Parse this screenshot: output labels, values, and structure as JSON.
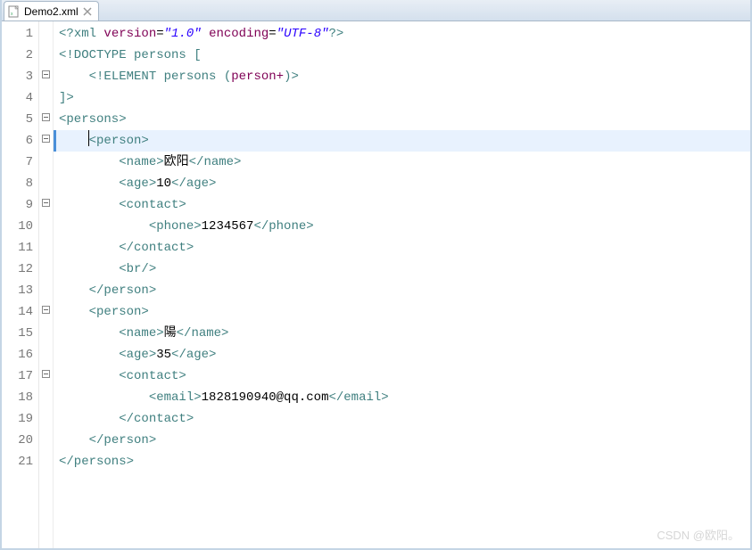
{
  "tab": {
    "filename": "Demo2.xml"
  },
  "lines": [
    {
      "num": "1",
      "fold": false,
      "highlight": false,
      "indent": 0,
      "segments": [
        {
          "t": "<?",
          "c": "tag"
        },
        {
          "t": "xml ",
          "c": "tag"
        },
        {
          "t": "version",
          "c": "attr"
        },
        {
          "t": "=",
          "c": "txt"
        },
        {
          "t": "\"1.0\"",
          "c": "val"
        },
        {
          "t": " ",
          "c": "txt"
        },
        {
          "t": "encoding",
          "c": "attr"
        },
        {
          "t": "=",
          "c": "txt"
        },
        {
          "t": "\"UTF-8\"",
          "c": "val"
        },
        {
          "t": "?>",
          "c": "tag"
        }
      ]
    },
    {
      "num": "2",
      "fold": false,
      "highlight": false,
      "indent": 0,
      "segments": [
        {
          "t": "<!DOCTYPE ",
          "c": "doctype"
        },
        {
          "t": "persons ",
          "c": "elname"
        },
        {
          "t": "[",
          "c": "brack"
        }
      ]
    },
    {
      "num": "3",
      "fold": true,
      "highlight": false,
      "indent": 1,
      "segments": [
        {
          "t": "<!ELEMENT ",
          "c": "doctype"
        },
        {
          "t": "persons ",
          "c": "elname"
        },
        {
          "t": "(",
          "c": "brack"
        },
        {
          "t": "person+",
          "c": "kw"
        },
        {
          "t": ")>",
          "c": "brack"
        }
      ]
    },
    {
      "num": "4",
      "fold": false,
      "highlight": false,
      "indent": 0,
      "segments": [
        {
          "t": "]>",
          "c": "brack"
        }
      ]
    },
    {
      "num": "5",
      "fold": true,
      "highlight": false,
      "indent": 0,
      "segments": [
        {
          "t": "<persons>",
          "c": "tag"
        }
      ]
    },
    {
      "num": "6",
      "fold": true,
      "highlight": true,
      "indent": 1,
      "segments": [
        {
          "t": "<person>",
          "c": "tag"
        }
      ]
    },
    {
      "num": "7",
      "fold": false,
      "highlight": false,
      "indent": 2,
      "segments": [
        {
          "t": "<name>",
          "c": "tag"
        },
        {
          "t": "欧阳",
          "c": "txt"
        },
        {
          "t": "</name>",
          "c": "tag"
        }
      ]
    },
    {
      "num": "8",
      "fold": false,
      "highlight": false,
      "indent": 2,
      "segments": [
        {
          "t": "<age>",
          "c": "tag"
        },
        {
          "t": "10",
          "c": "num"
        },
        {
          "t": "</age>",
          "c": "tag"
        }
      ]
    },
    {
      "num": "9",
      "fold": true,
      "highlight": false,
      "indent": 2,
      "segments": [
        {
          "t": "<contact>",
          "c": "tag"
        }
      ]
    },
    {
      "num": "10",
      "fold": false,
      "highlight": false,
      "indent": 3,
      "segments": [
        {
          "t": "<phone>",
          "c": "tag"
        },
        {
          "t": "1234567",
          "c": "num"
        },
        {
          "t": "</phone>",
          "c": "tag"
        }
      ]
    },
    {
      "num": "11",
      "fold": false,
      "highlight": false,
      "indent": 2,
      "segments": [
        {
          "t": "</contact>",
          "c": "tag"
        }
      ]
    },
    {
      "num": "12",
      "fold": false,
      "highlight": false,
      "indent": 2,
      "segments": [
        {
          "t": "<br/>",
          "c": "tag"
        }
      ]
    },
    {
      "num": "13",
      "fold": false,
      "highlight": false,
      "indent": 1,
      "segments": [
        {
          "t": "</person>",
          "c": "tag"
        }
      ]
    },
    {
      "num": "14",
      "fold": true,
      "highlight": false,
      "indent": 1,
      "segments": [
        {
          "t": "<person>",
          "c": "tag"
        }
      ]
    },
    {
      "num": "15",
      "fold": false,
      "highlight": false,
      "indent": 2,
      "segments": [
        {
          "t": "<name>",
          "c": "tag"
        },
        {
          "t": "陽",
          "c": "txt"
        },
        {
          "t": "</name>",
          "c": "tag"
        }
      ]
    },
    {
      "num": "16",
      "fold": false,
      "highlight": false,
      "indent": 2,
      "segments": [
        {
          "t": "<age>",
          "c": "tag"
        },
        {
          "t": "35",
          "c": "num"
        },
        {
          "t": "</age>",
          "c": "tag"
        }
      ]
    },
    {
      "num": "17",
      "fold": true,
      "highlight": false,
      "indent": 2,
      "segments": [
        {
          "t": "<contact>",
          "c": "tag"
        }
      ]
    },
    {
      "num": "18",
      "fold": false,
      "highlight": false,
      "indent": 3,
      "segments": [
        {
          "t": "<email>",
          "c": "tag"
        },
        {
          "t": "1828190940@qq.com",
          "c": "num"
        },
        {
          "t": "</email>",
          "c": "tag"
        }
      ]
    },
    {
      "num": "19",
      "fold": false,
      "highlight": false,
      "indent": 2,
      "segments": [
        {
          "t": "</contact>",
          "c": "tag"
        }
      ]
    },
    {
      "num": "20",
      "fold": false,
      "highlight": false,
      "indent": 1,
      "segments": [
        {
          "t": "</person>",
          "c": "tag"
        }
      ]
    },
    {
      "num": "21",
      "fold": false,
      "highlight": false,
      "indent": 0,
      "segments": [
        {
          "t": "</persons>",
          "c": "tag"
        }
      ]
    }
  ],
  "watermark": "CSDN @欧阳。"
}
